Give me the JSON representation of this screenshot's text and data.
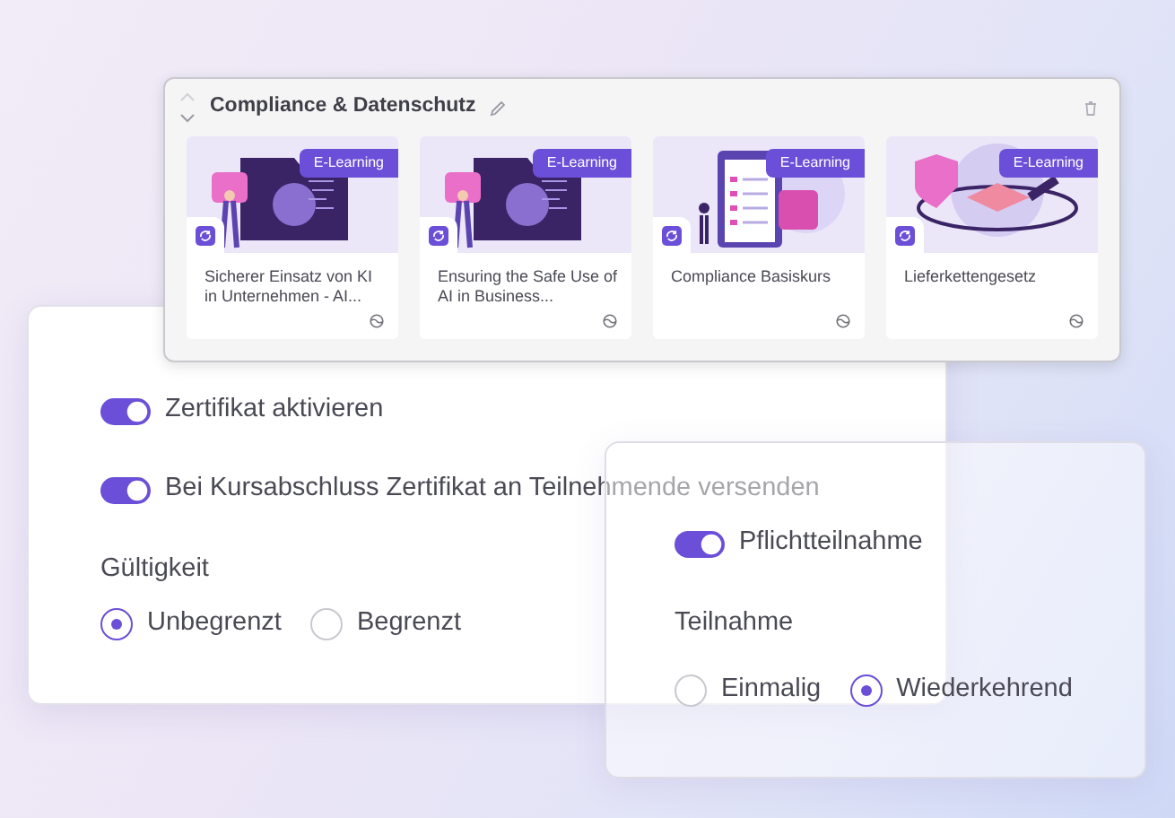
{
  "course_group": {
    "title": "Compliance & Datenschutz",
    "courses": [
      {
        "title": "Sicherer Einsatz von KI in Unternehmen - AI...",
        "badge": "E-Learning"
      },
      {
        "title": "Ensuring the Safe Use of AI in Business...",
        "badge": "E-Learning"
      },
      {
        "title": "Compliance Basiskurs",
        "badge": "E-Learning"
      },
      {
        "title": "Lieferkettengesetz",
        "badge": "E-Learning"
      }
    ]
  },
  "certificate_panel": {
    "toggles": [
      {
        "label": "Zertifikat aktivieren",
        "on": true
      },
      {
        "label": "Bei Kursabschluss Zertifikat an Teilnehmende versenden",
        "on": true
      }
    ],
    "validity": {
      "label": "Gültigkeit",
      "options": [
        {
          "label": "Unbegrenzt",
          "selected": true
        },
        {
          "label": "Begrenzt",
          "selected": false
        }
      ]
    }
  },
  "participation_panel": {
    "toggle": {
      "label": "Pflichtteilnahme",
      "on": true
    },
    "participation": {
      "label": "Teilnahme",
      "options": [
        {
          "label": "Einmalig",
          "selected": false
        },
        {
          "label": "Wiederkehrend",
          "selected": true
        }
      ]
    }
  }
}
